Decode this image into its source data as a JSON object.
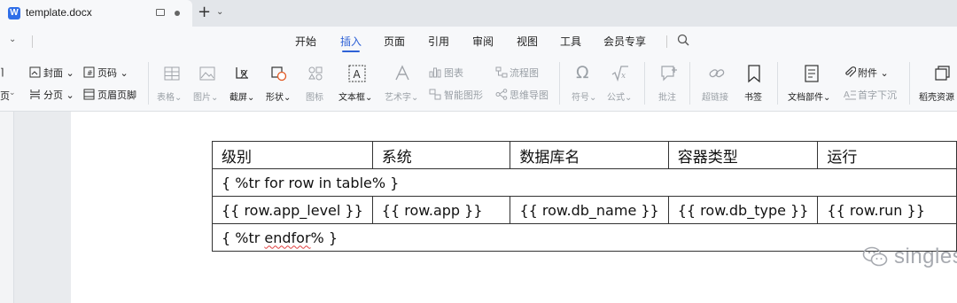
{
  "tab": {
    "title": "template.docx",
    "logo_letter": "W"
  },
  "menu": {
    "items": [
      "开始",
      "插入",
      "页面",
      "引用",
      "审阅",
      "视图",
      "工具",
      "会员专享"
    ],
    "active": "插入"
  },
  "ribbon": {
    "cover": "封面",
    "page_num": "页码",
    "page_break": "分页",
    "header_footer": "页眉页脚",
    "page_left_top": " ",
    "page_left_bottom": "页",
    "table": "表格",
    "picture": "图片",
    "screenshot": "截屏",
    "shape": "形状",
    "icon": "图标",
    "textbox": "文本框",
    "wordart": "艺术字",
    "chart": "图表",
    "smartart": "智能图形",
    "flowchart": "流程图",
    "mindmap": "思维导图",
    "symbol": "符号",
    "formula": "公式",
    "comment": "批注",
    "hyperlink": "超链接",
    "bookmark": "书签",
    "doc_parts": "文档部件",
    "attachment": "附件",
    "drop_cap": "首字下沉",
    "resources": "稻壳资源"
  },
  "table": {
    "headers": [
      "级别",
      "系统",
      "数据库名",
      "容器类型",
      "运行"
    ],
    "loop_start": "{ %tr for row in table% }",
    "row_cells": [
      "{{ row.app_level }}",
      "{{ row.app }}",
      "{{ row.db_name }}",
      "{{ row.db_type }}",
      "{{ row.run }}"
    ],
    "loop_end_prefix": "{ %tr ",
    "loop_end_word": "endfor",
    "loop_end_suffix": "% }"
  },
  "watermark": {
    "text": "singless",
    "icon": "wechat-icon"
  },
  "colors": {
    "accent": "#2f62d6",
    "logo": "#2f6ee8"
  }
}
